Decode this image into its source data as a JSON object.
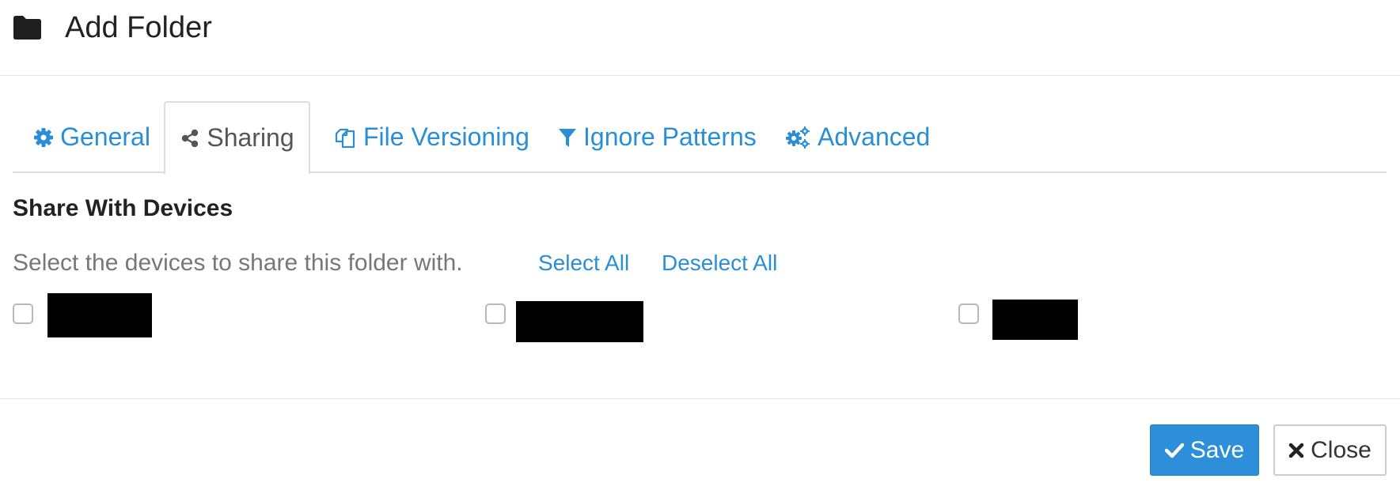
{
  "header": {
    "icon": "folder-icon",
    "title": "Add Folder"
  },
  "tabs": [
    {
      "label": "General",
      "icon": "gear-icon",
      "active": false
    },
    {
      "label": "Sharing",
      "icon": "share-icon",
      "active": true
    },
    {
      "label": "File Versioning",
      "icon": "copy-icon",
      "active": false
    },
    {
      "label": "Ignore Patterns",
      "icon": "filter-icon",
      "active": false
    },
    {
      "label": "Advanced",
      "icon": "gears-icon",
      "active": false
    }
  ],
  "sharing": {
    "title": "Share With Devices",
    "help_text": "Select the devices to share this folder with.",
    "select_all": "Select All",
    "deselect_all": "Deselect All",
    "devices": [
      {
        "name": "",
        "checked": false,
        "redacted": true
      },
      {
        "name": "",
        "checked": false,
        "redacted": true
      },
      {
        "name": "",
        "checked": false,
        "redacted": true
      }
    ]
  },
  "footer": {
    "save_label": "Save",
    "save_icon": "check-icon",
    "close_label": "Close",
    "close_icon": "close-icon"
  },
  "colors": {
    "link": "#2a8ed6",
    "primary_button": "#2d8fd9",
    "border": "#dddddd"
  }
}
